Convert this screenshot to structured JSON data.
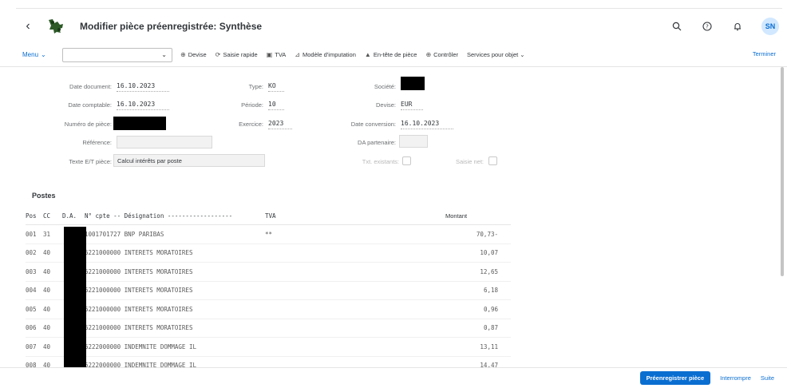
{
  "shell": {
    "title": "Modifier pièce préenregistrée: Synthèse",
    "back": "‹",
    "user_initials": "SN"
  },
  "toolbar": {
    "menu_label": "Menu",
    "select_value": "",
    "buttons": [
      {
        "icon": "⊕",
        "label": "Devise"
      },
      {
        "icon": "⟳",
        "label": "Saisie rapide"
      },
      {
        "icon": "▣",
        "label": "TVA"
      },
      {
        "icon": "⊿",
        "label": "Modèle d'imputation"
      },
      {
        "icon": "▲",
        "label": "En-tête de pièce"
      },
      {
        "icon": "⊕",
        "label": "Contrôler"
      }
    ],
    "services_label": "Services pour objet",
    "terminer_label": "Terminer"
  },
  "header": {
    "date_document_label": "Date document:",
    "date_document": "16.10.2023",
    "date_comptable_label": "Date comptable:",
    "date_comptable": "16.10.2023",
    "numero_piece_label": "Numéro de pièce:",
    "reference_label": "Référence:",
    "texte_piece_label": "Texte E/T pièce:",
    "texte_piece": "Calcul intérêts par poste",
    "type_label": "Type:",
    "type": "KO",
    "periode_label": "Période:",
    "periode": "10",
    "exercice_label": "Exercice:",
    "exercice": "2023",
    "societe_label": "Société:",
    "devise_label": "Devise:",
    "devise": "EUR",
    "date_conversion_label": "Date conversion:",
    "date_conversion": "16.10.2023",
    "da_partenaire_label": "DA partenaire:",
    "txt_existants_label": "Txt. existants:",
    "saisie_net_label": "Saisie net:"
  },
  "postes": {
    "title": "Postes",
    "columns": {
      "pos": "Pos",
      "cc": "CC",
      "da": "D.A.",
      "cpte": "N° cpte -- Désignation ------------------",
      "tva": "TVA",
      "montant": "Montant"
    },
    "rows": [
      {
        "pos": "001",
        "cc": "31",
        "cpte": "1001701727 BNP PARIBAS",
        "tva": "**",
        "montant": "70,73-"
      },
      {
        "pos": "002",
        "cc": "40",
        "cpte": "6221000000 INTERETS MORATOIRES",
        "tva": "",
        "montant": "10,07"
      },
      {
        "pos": "003",
        "cc": "40",
        "cpte": "6221000000 INTERETS MORATOIRES",
        "tva": "",
        "montant": "12,65"
      },
      {
        "pos": "004",
        "cc": "40",
        "cpte": "6221000000 INTERETS MORATOIRES",
        "tva": "",
        "montant": "6,18"
      },
      {
        "pos": "005",
        "cc": "40",
        "cpte": "6221000000 INTERETS MORATOIRES",
        "tva": "",
        "montant": "0,96"
      },
      {
        "pos": "006",
        "cc": "40",
        "cpte": "6221000000 INTERETS MORATOIRES",
        "tva": "",
        "montant": "0,87"
      },
      {
        "pos": "007",
        "cc": "40",
        "cpte": "6222000000 INDEMNITE DOMMAGE IL",
        "tva": "",
        "montant": "13,11"
      },
      {
        "pos": "008",
        "cc": "40",
        "cpte": "6222000000 INDEMNITE DOMMAGE IL",
        "tva": "",
        "montant": "14,47"
      }
    ]
  },
  "footer": {
    "preenregistrer": "Préenregistrer pièce",
    "interrompre": "Interrompre",
    "suite": "Suite"
  },
  "colors": {
    "accent": "#0a6ed1",
    "text": "#32363a",
    "label": "#6a6d70"
  }
}
